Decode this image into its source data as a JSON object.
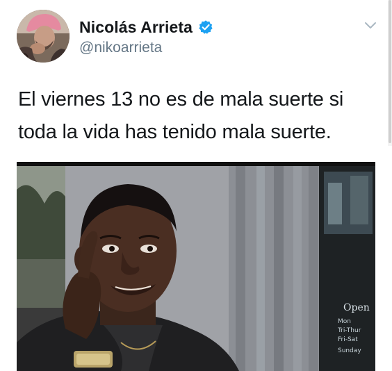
{
  "tweet": {
    "author": {
      "display_name": "Nicolás Arrieta",
      "handle": "@nikoarrieta",
      "verified": true,
      "avatar_icon": "profile-photo"
    },
    "text": "El viernes 13 no es de mala suerte si toda la vida has tenido mala suerte.",
    "menu_icon": "chevron-down-icon",
    "media": {
      "type": "photo",
      "sign_text": {
        "open": "Open",
        "line1": "Mon",
        "line2": "Tri-Thur",
        "line3": "Fri-Sat",
        "line4": "Sunday"
      }
    }
  },
  "colors": {
    "verified_badge": "#1da1f2",
    "handle_gray": "#657786",
    "text_dark": "#14171a"
  }
}
